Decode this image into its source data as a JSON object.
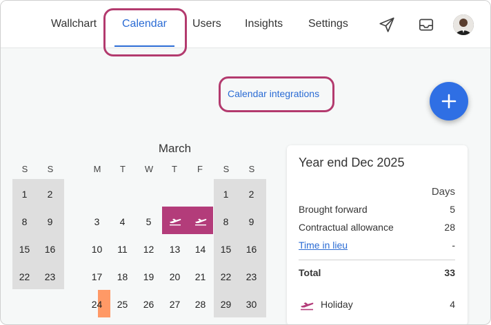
{
  "nav": {
    "items": [
      {
        "label": "Wallchart"
      },
      {
        "label": "Calendar"
      },
      {
        "label": "Users"
      },
      {
        "label": "Insights"
      },
      {
        "label": "Settings"
      }
    ],
    "icons": [
      "paper-plane-icon",
      "inbox-icon"
    ],
    "accent": "#2a6bd4"
  },
  "integrations": {
    "label": "Calendar integrations"
  },
  "fab": {
    "icon": "plus-icon",
    "color": "#2f6fe4"
  },
  "calendar": {
    "month": "March",
    "weekdays": [
      "S",
      "S",
      "M",
      "T",
      "W",
      "T",
      "F",
      "S",
      "S"
    ],
    "days": [
      "1",
      "2",
      "1",
      "2",
      "8",
      "9",
      "3",
      "4",
      "5",
      "8",
      "9",
      "15",
      "16",
      "10",
      "11",
      "12",
      "13",
      "14",
      "15",
      "16",
      "22",
      "23",
      "17",
      "18",
      "19",
      "20",
      "21",
      "22",
      "23",
      "24",
      "25",
      "26",
      "27",
      "28",
      "29",
      "30"
    ],
    "trip_icon": "plane-departure-icon",
    "trip_color": "#b33c7a",
    "today_color": "#ff9966"
  },
  "summary": {
    "title": "Year end Dec 2025",
    "days_header": "Days",
    "rows": [
      {
        "label": "Brought forward",
        "value": "5"
      },
      {
        "label": "Contractual allowance",
        "value": "28"
      },
      {
        "label": "Time in lieu",
        "value": "-"
      }
    ],
    "total": {
      "label": "Total",
      "value": "33"
    },
    "holiday": {
      "label": "Holiday",
      "value": "4",
      "icon": "plane-departure-icon"
    }
  }
}
